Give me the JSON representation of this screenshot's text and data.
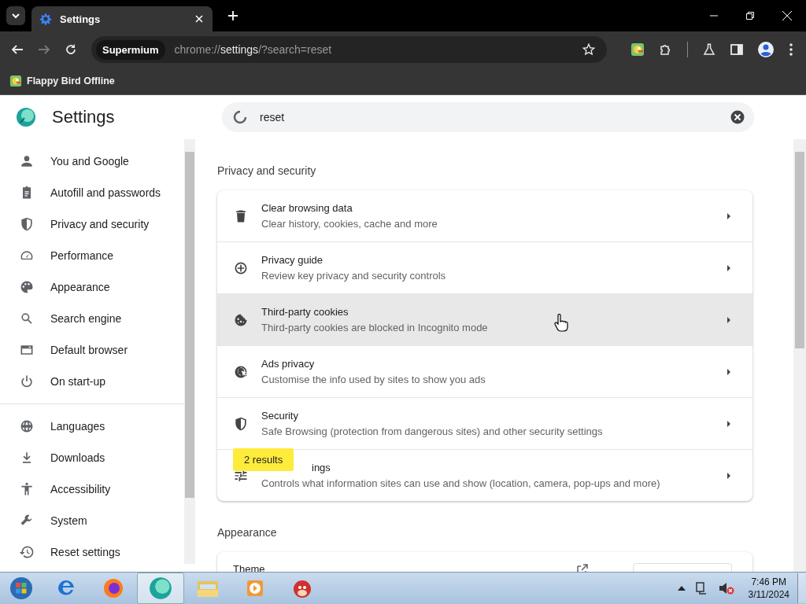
{
  "tabs": [
    {
      "title": "Settings",
      "selected": true
    }
  ],
  "toolbar": {
    "chip": "Supermium",
    "url_prefix": "chrome://",
    "url_host": "settings",
    "url_rest": "/?search=reset"
  },
  "bookmarks": [
    {
      "label": "Flappy Bird Offline"
    }
  ],
  "sidebar": {
    "title": "Settings",
    "groups": [
      [
        {
          "label": "You and Google"
        },
        {
          "label": "Autofill and passwords"
        },
        {
          "label": "Privacy and security"
        },
        {
          "label": "Performance"
        },
        {
          "label": "Appearance"
        },
        {
          "label": "Search engine"
        },
        {
          "label": "Default browser"
        },
        {
          "label": "On start-up"
        }
      ],
      [
        {
          "label": "Languages"
        },
        {
          "label": "Downloads"
        },
        {
          "label": "Accessibility"
        },
        {
          "label": "System"
        },
        {
          "label": "Reset settings"
        }
      ]
    ]
  },
  "search": {
    "value": "reset"
  },
  "sections": [
    {
      "title": "Privacy and security",
      "rows": [
        {
          "kind": "link",
          "title": "Clear browsing data",
          "subtitle": "Clear history, cookies, cache and more",
          "hovered": false
        },
        {
          "kind": "link",
          "title": "Privacy guide",
          "subtitle": "Review key privacy and security controls",
          "hovered": false
        },
        {
          "kind": "link",
          "title": "Third-party cookies",
          "subtitle": "Third-party cookies are blocked in Incognito mode",
          "hovered": true
        },
        {
          "kind": "link",
          "title": "Ads privacy",
          "subtitle": "Customise the info used by sites to show you ads",
          "hovered": false
        },
        {
          "kind": "link",
          "title": "Security",
          "subtitle": "Safe Browsing (protection from dangerous sites) and other security settings",
          "hovered": false
        },
        {
          "kind": "link",
          "title": "ings",
          "subtitle": "Controls what information sites can use and show (location, camera, pop-ups and more)",
          "hovered": false,
          "badge": "2 results"
        }
      ]
    },
    {
      "title": "Appearance",
      "rows": [
        {
          "kind": "theme",
          "title": "Theme"
        }
      ]
    }
  ],
  "taskbar": {
    "time": "7:46 PM",
    "date": "3/11/2024"
  }
}
